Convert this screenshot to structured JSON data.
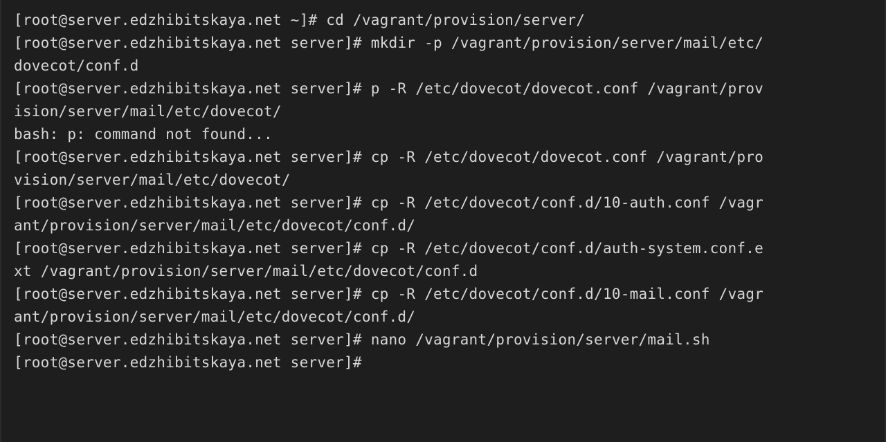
{
  "terminal": {
    "lines": [
      "[root@server.edzhibitskaya.net ~]# cd /vagrant/provision/server/",
      "[root@server.edzhibitskaya.net server]# mkdir -p /vagrant/provision/server/mail/etc/",
      "dovecot/conf.d",
      "[root@server.edzhibitskaya.net server]# p -R /etc/dovecot/dovecot.conf /vagrant/prov",
      "ision/server/mail/etc/dovecot/",
      "bash: p: command not found...",
      "[root@server.edzhibitskaya.net server]# cp -R /etc/dovecot/dovecot.conf /vagrant/pro",
      "vision/server/mail/etc/dovecot/",
      "[root@server.edzhibitskaya.net server]# cp -R /etc/dovecot/conf.d/10-auth.conf /vagr",
      "ant/provision/server/mail/etc/dovecot/conf.d/",
      "[root@server.edzhibitskaya.net server]# cp -R /etc/dovecot/conf.d/auth-system.conf.e",
      "xt /vagrant/provision/server/mail/etc/dovecot/conf.d",
      "[root@server.edzhibitskaya.net server]# cp -R /etc/dovecot/conf.d/10-mail.conf /vagr",
      "ant/provision/server/mail/etc/dovecot/conf.d/",
      "[root@server.edzhibitskaya.net server]# nano /vagrant/provision/server/mail.sh",
      "[root@server.edzhibitskaya.net server]#"
    ]
  },
  "colors": {
    "background": "#1e1e1e",
    "text": "#d7d7d7"
  }
}
